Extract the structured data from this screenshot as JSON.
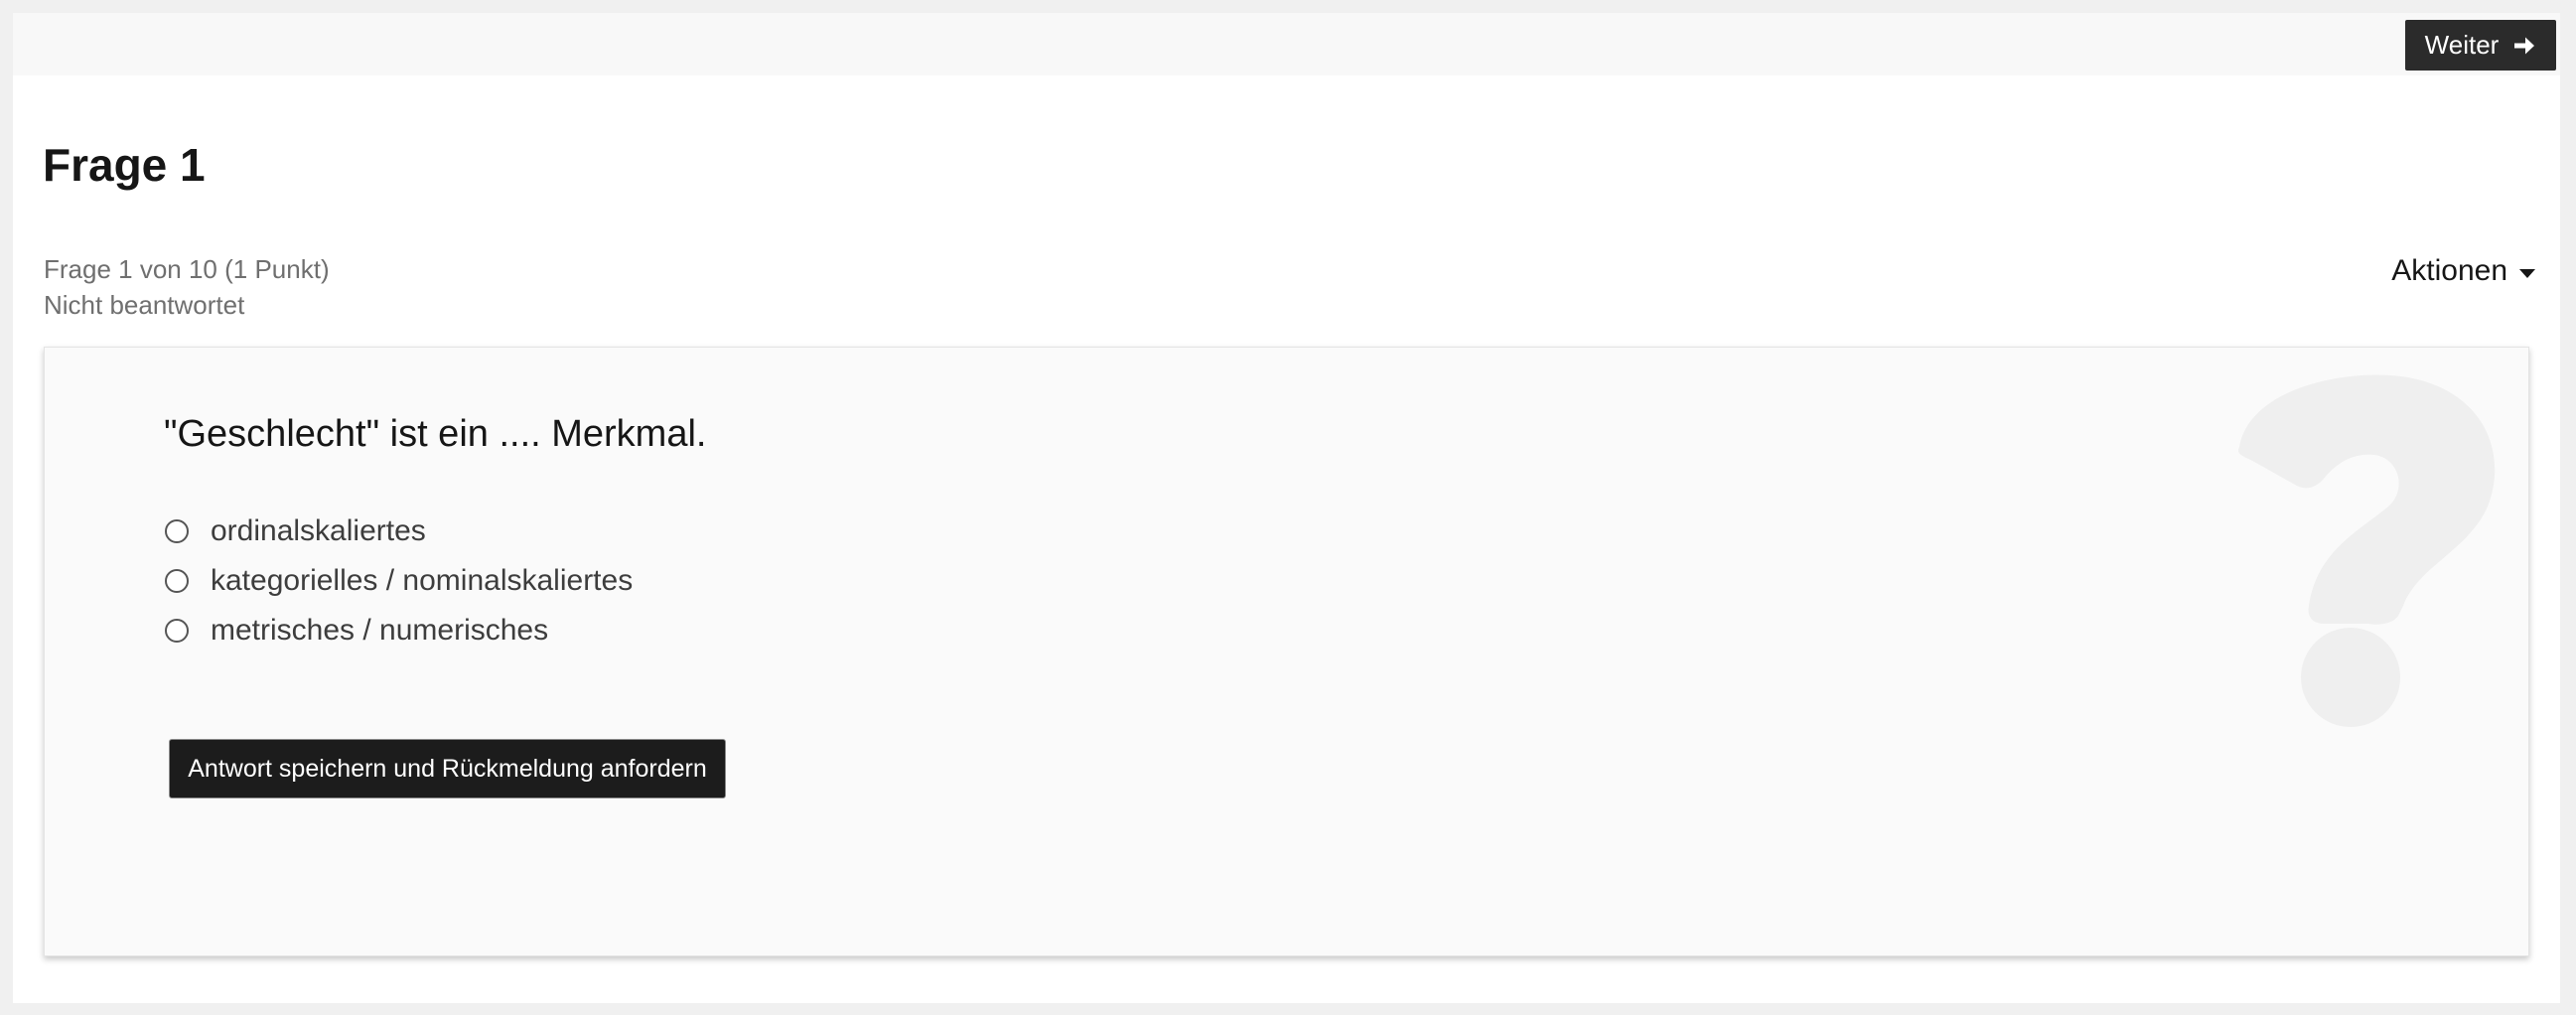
{
  "nav": {
    "next_label": "Weiter",
    "next_icon": "arrow-right-icon"
  },
  "question": {
    "title": "Frage 1",
    "progress": "Frage 1 von 10 (1 Punkt)",
    "status": "Nicht beantwortet",
    "actions_label": "Aktionen",
    "text": "\"Geschlecht\" ist ein .... Merkmal.",
    "options": [
      {
        "label": "ordinalskaliertes",
        "selected": false
      },
      {
        "label": "kategorielles / nominalskaliertes",
        "selected": false
      },
      {
        "label": "metrisches / numerisches",
        "selected": false
      }
    ],
    "submit_label": "Antwort speichern und Rückmeldung anfordern",
    "background_icon": "question-mark-icon"
  },
  "colors": {
    "button_dark": "#2b2b2b",
    "text": "#161616",
    "muted": "#6f6f6f",
    "card_bg": "#fafafa"
  }
}
